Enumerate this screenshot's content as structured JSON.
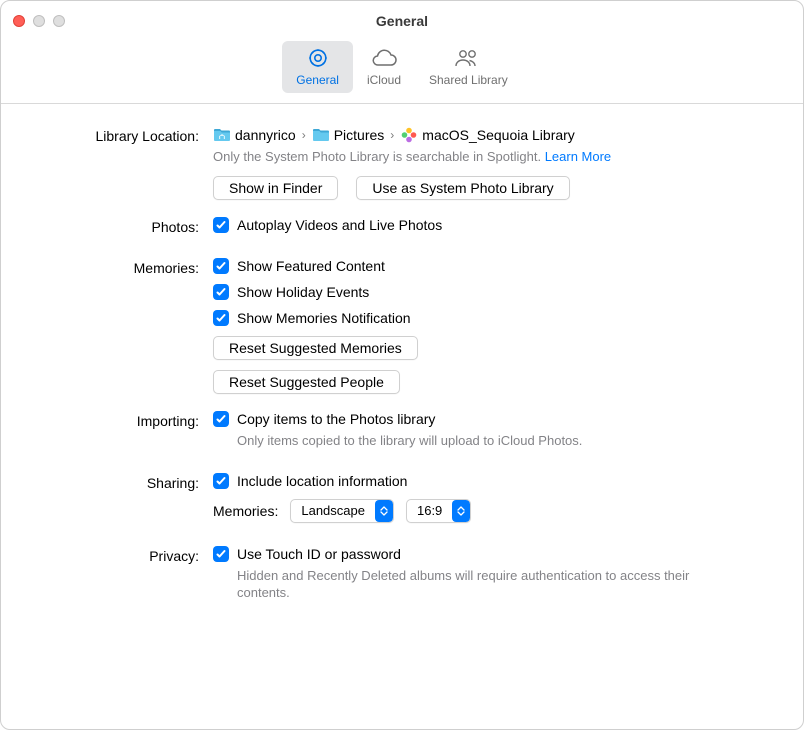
{
  "window": {
    "title": "General"
  },
  "tabs": {
    "general": "General",
    "icloud": "iCloud",
    "shared_library": "Shared Library"
  },
  "library_location": {
    "label": "Library Location:",
    "crumbs": {
      "home": "dannyrico",
      "folder": "Pictures",
      "library": "macOS_Sequoia Library"
    },
    "spotlight_hint": "Only the System Photo Library is searchable in Spotlight.",
    "learn_more": "Learn More",
    "show_in_finder": "Show in Finder",
    "use_as_system": "Use as System Photo Library"
  },
  "photos": {
    "label": "Photos:",
    "autoplay": "Autoplay Videos and Live Photos"
  },
  "memories": {
    "label": "Memories:",
    "featured": "Show Featured Content",
    "holiday": "Show Holiday Events",
    "notifications": "Show Memories Notification",
    "reset_memories": "Reset Suggested Memories",
    "reset_people": "Reset Suggested People"
  },
  "importing": {
    "label": "Importing:",
    "copy": "Copy items to the Photos library",
    "hint": "Only items copied to the library will upload to iCloud Photos."
  },
  "sharing": {
    "label": "Sharing:",
    "include_location": "Include location information",
    "memories_label": "Memories:",
    "orientation": "Landscape",
    "aspect": "16:9"
  },
  "privacy": {
    "label": "Privacy:",
    "touchid": "Use Touch ID or password",
    "hint": "Hidden and Recently Deleted albums will require authentication to access their contents."
  }
}
